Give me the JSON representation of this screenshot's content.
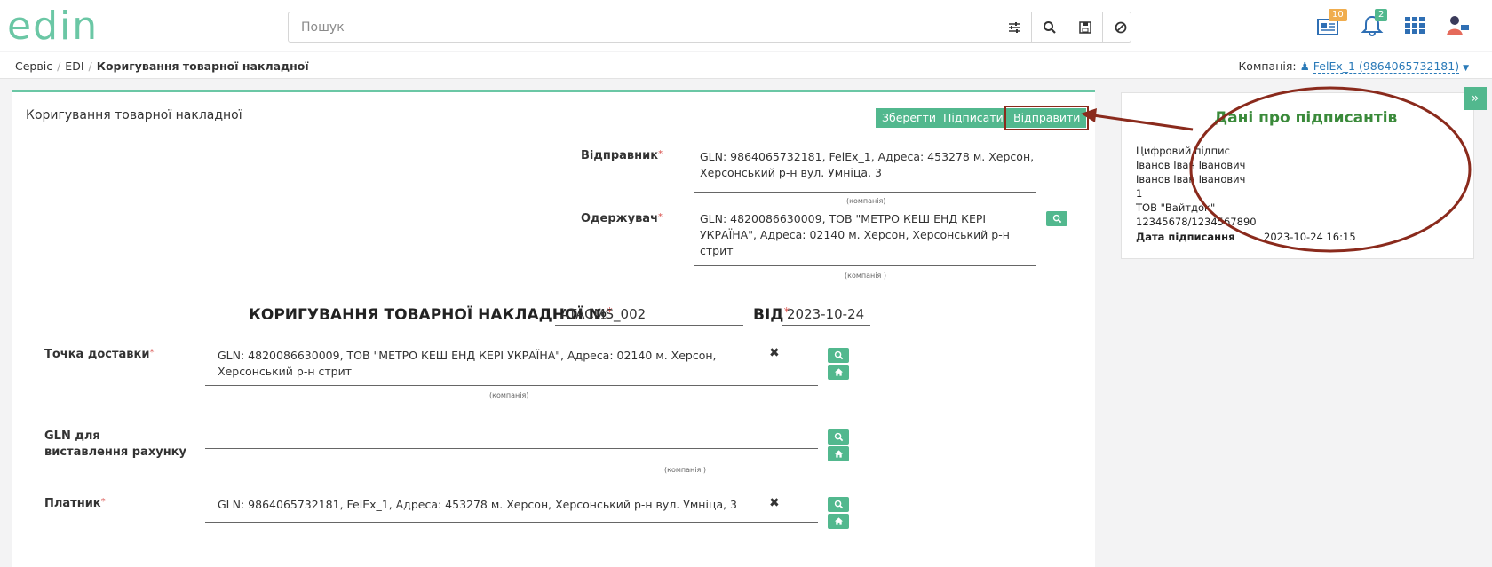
{
  "header": {
    "logo_text": "edin",
    "search_placeholder": "Пошук",
    "news_count": "10",
    "notifications_count": "2"
  },
  "breadcrumb": {
    "items": [
      "Сервіс",
      "EDI"
    ],
    "current": "Коригування товарної накладної"
  },
  "company": {
    "label": "Компанія:",
    "value": "FelEx_1 (9864065732181)"
  },
  "card": {
    "title": "Коригування товарної накладної",
    "buttons": {
      "save": "Зберегти",
      "sign": "Підписати",
      "send": "Відправити"
    }
  },
  "form": {
    "sender_label": "Відправник",
    "sender_value": "GLN: 9864065732181, FelEx_1, Адреса: 453278 м. Херсон, Херсонський р-н вул. Умніца, 3",
    "sender_hint": "(компанія)",
    "receiver_label": "Одержувач",
    "receiver_value": "GLN: 4820086630009, ТОВ \"МЕТРО КЕШ ЕНД КЕРІ УКРАЇНА\", Адреса: 02140 м. Херсон, Херсонський р-н стрит",
    "receiver_hint": "(компанія )",
    "doc_title": "КОРИГУВАННЯ ТОВАРНОЇ НАКЛАДНОЇ №",
    "doc_number": "ATACMS_002",
    "date_label": "ВІД",
    "doc_date": "2023-10-24",
    "delivery_label": "Точка доставки",
    "delivery_value": "GLN: 4820086630009, ТОВ \"МЕТРО КЕШ ЕНД КЕРІ УКРАЇНА\", Адреса: 02140 м. Херсон, Херсонський р-н стрит",
    "delivery_hint": "(компанія)",
    "billing_label": "GLN для виставлення рахунку",
    "billing_hint": "(компанія )",
    "payer_label": "Платник",
    "payer_value": "GLN: 9864065732181, FelEx_1, Адреса: 453278 м. Херсон, Херсонський р-н вул. Умніца, 3"
  },
  "signers": {
    "title": "Дані про підписантів",
    "lines": [
      "Цифровий підпис",
      "Іванов Іван Іванович",
      "Іванов Іван Іванович",
      "1",
      "ТОВ \"Вайтдок\"",
      "12345678/1234567890"
    ],
    "date_label": "Дата підписання",
    "date_value": "2023-10-24 16:15"
  },
  "colors": {
    "accent": "#52b88e",
    "annotation": "#8a2a1c",
    "logo": "#6bc7a5"
  }
}
